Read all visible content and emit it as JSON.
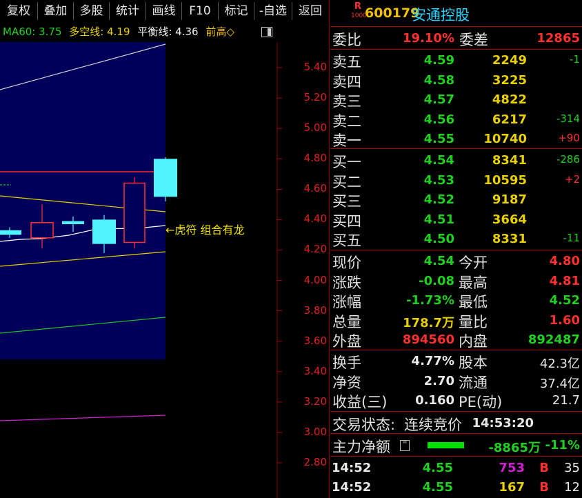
{
  "toolbar": {
    "buttons": [
      "复权",
      "叠加",
      "多股",
      "统计",
      "画线",
      "F10",
      "标记",
      "-自选",
      "返回"
    ]
  },
  "indicators": {
    "ma60": "MA60: 3.75",
    "duokong": "多空线: 4.19",
    "pingheng": "平衡线: 4.36",
    "qiangao": "前高◇"
  },
  "chart": {
    "annotation": "←虎符 组合有龙",
    "axis_labels": [
      "5.40",
      "5.20",
      "5.00",
      "4.80",
      "4.60",
      "4.40",
      "4.20",
      "4.00",
      "3.80",
      "3.60",
      "3.40",
      "3.20",
      "3.00",
      "2.80"
    ]
  },
  "chart_data": {
    "type": "candlestick",
    "ylim": [
      2.8,
      5.4
    ],
    "ticks": [
      5.4,
      5.2,
      5.0,
      4.8,
      4.6,
      4.4,
      4.2,
      4.0,
      3.8,
      3.6,
      3.4,
      3.2,
      3.0,
      2.8
    ],
    "candles": [
      {
        "open": 4.33,
        "close": 4.3,
        "high": 4.35,
        "low": 4.28,
        "color": "cyan"
      },
      {
        "open": 4.28,
        "close": 4.38,
        "high": 4.5,
        "low": 4.21,
        "color": "red"
      },
      {
        "open": 4.39,
        "close": 4.37,
        "high": 4.42,
        "low": 4.32,
        "color": "cyan"
      },
      {
        "open": 4.4,
        "close": 4.24,
        "high": 4.43,
        "low": 4.18,
        "color": "cyan"
      },
      {
        "open": 4.25,
        "close": 4.64,
        "high": 4.68,
        "low": 4.21,
        "color": "red"
      },
      {
        "open": 4.8,
        "close": 4.55,
        "high": 4.81,
        "low": 4.52,
        "color": "cyan"
      }
    ]
  },
  "quote": {
    "r_badge": "R",
    "r_sub": "1000",
    "code": "600179",
    "name": "安通控股",
    "weibi_label": "委比",
    "weibi": "19.10%",
    "weicha_label": "委差",
    "weicha": "12865",
    "asks": [
      {
        "label": "卖五",
        "price": "4.59",
        "vol": "2249",
        "chg": "-1"
      },
      {
        "label": "卖四",
        "price": "4.58",
        "vol": "3225",
        "chg": ""
      },
      {
        "label": "卖三",
        "price": "4.57",
        "vol": "4822",
        "chg": ""
      },
      {
        "label": "卖二",
        "price": "4.56",
        "vol": "6217",
        "chg": "-314"
      },
      {
        "label": "卖一",
        "price": "4.55",
        "vol": "10740",
        "chg": "+90"
      }
    ],
    "bids": [
      {
        "label": "买一",
        "price": "4.54",
        "vol": "8341",
        "chg": "-286"
      },
      {
        "label": "买二",
        "price": "4.53",
        "vol": "10595",
        "chg": "+2"
      },
      {
        "label": "买三",
        "price": "4.52",
        "vol": "9187",
        "chg": ""
      },
      {
        "label": "买四",
        "price": "4.51",
        "vol": "3664",
        "chg": ""
      },
      {
        "label": "买五",
        "price": "4.50",
        "vol": "8331",
        "chg": "-11"
      }
    ],
    "stats1": [
      {
        "l1": "现价",
        "v1": "4.54",
        "c1": "g",
        "l2": "今开",
        "v2": "4.80",
        "c2": "r"
      },
      {
        "l1": "涨跌",
        "v1": "-0.08",
        "c1": "g",
        "l2": "最高",
        "v2": "4.81",
        "c2": "r"
      },
      {
        "l1": "涨幅",
        "v1": "-1.73%",
        "c1": "g",
        "l2": "最低",
        "v2": "4.52",
        "c2": "g"
      },
      {
        "l1": "总量",
        "v1": "178.7万",
        "c1": "y",
        "l2": "量比",
        "v2": "1.60",
        "c2": "r"
      },
      {
        "l1": "外盘",
        "v1": "894560",
        "c1": "r",
        "l2": "内盘",
        "v2": "892487",
        "c2": "g"
      }
    ],
    "stats2": [
      {
        "l1": "换手",
        "v1": "4.77%",
        "l2": "股本",
        "v2": "42.3亿"
      },
      {
        "l1": "净资",
        "v1": "2.70",
        "l2": "流通",
        "v2": "37.4亿"
      },
      {
        "l1": "收益(三)",
        "v1": "0.160",
        "l2": "PE(动)",
        "v2": "21.7"
      }
    ],
    "trade_status_label": "交易状态:",
    "trade_status": "连续竞价",
    "trade_time": "14:53:20",
    "main_force_label": "主力净额",
    "main_force_value": "-8865万",
    "main_force_pct": "-11%",
    "ticks": [
      {
        "time": "14:52",
        "price": "4.55",
        "vol": "753",
        "side": "B",
        "n": "35",
        "volcolor": "m"
      },
      {
        "time": "14:52",
        "price": "4.55",
        "vol": "167",
        "side": "B",
        "n": "12",
        "volcolor": "y"
      }
    ]
  }
}
